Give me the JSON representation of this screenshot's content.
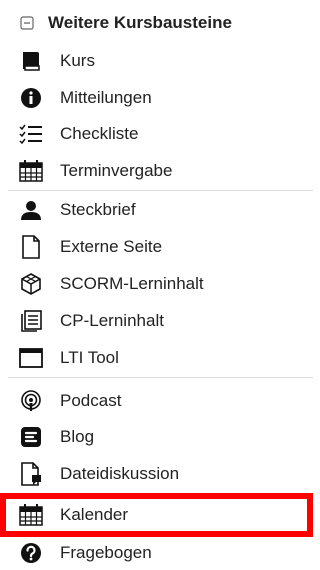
{
  "section": {
    "title": "Weitere Kursbausteine",
    "items": [
      {
        "label": "Kurs",
        "icon": "book-icon"
      },
      {
        "label": "Mitteilungen",
        "icon": "info-circle-icon"
      },
      {
        "label": "Checkliste",
        "icon": "checklist-icon"
      },
      {
        "label": "Terminvergabe",
        "icon": "calendar-icon"
      },
      {
        "label": "Steckbrief",
        "icon": "user-icon"
      },
      {
        "label": "Externe Seite",
        "icon": "page-icon"
      },
      {
        "label": "SCORM-Lerninhalt",
        "icon": "package-icon"
      },
      {
        "label": "CP-Lerninhalt",
        "icon": "content-package-icon"
      },
      {
        "label": "LTI Tool",
        "icon": "window-icon"
      },
      {
        "label": "Podcast",
        "icon": "podcast-icon"
      },
      {
        "label": "Blog",
        "icon": "blog-icon"
      },
      {
        "label": "Dateidiskussion",
        "icon": "file-discussion-icon"
      },
      {
        "label": "Kalender",
        "icon": "calendar-icon"
      },
      {
        "label": "Fragebogen",
        "icon": "question-icon"
      }
    ]
  },
  "highlight_color": "#ff0000"
}
